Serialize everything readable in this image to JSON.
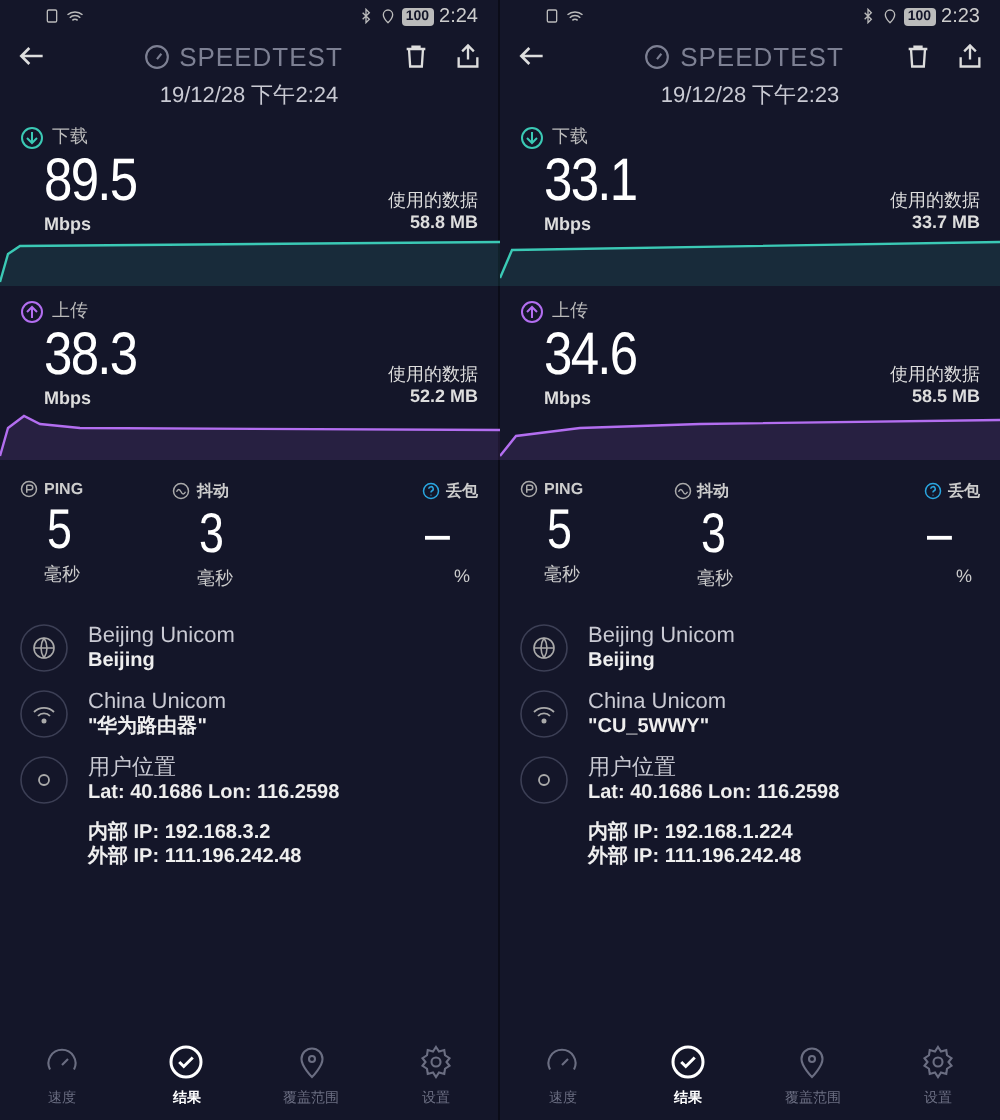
{
  "screens": [
    {
      "status_bar": {
        "battery": "100",
        "time": "2:24"
      },
      "header": {
        "title": "SPEEDTEST"
      },
      "timestamp": "19/12/28 下午2:24",
      "results": [
        {
          "kind": "download",
          "label": "下载",
          "value": "89.5",
          "unit": "Mbps",
          "data_label": "使用的数据",
          "data_value": "58.8 MB"
        },
        {
          "kind": "upload",
          "label": "上传",
          "value": "38.3",
          "unit": "Mbps",
          "data_label": "使用的数据",
          "data_value": "52.2 MB"
        }
      ],
      "stats": [
        {
          "kind": "ping",
          "label": "PING",
          "value": "5",
          "unit": "毫秒"
        },
        {
          "kind": "jitter",
          "label": "抖动",
          "value": "3",
          "unit": "毫秒"
        },
        {
          "kind": "loss",
          "label": "丢包",
          "value": "–",
          "unit": "%"
        }
      ],
      "info": [
        {
          "kind": "server",
          "lines": [
            "Beijing Unicom",
            "Beijing"
          ]
        },
        {
          "kind": "network",
          "lines": [
            "China Unicom",
            "\"华为路由器\""
          ]
        },
        {
          "kind": "location",
          "lines": [
            "用户位置",
            "Lat: 40.1686 Lon: 116.2598",
            "内部 IP: 192.168.3.2",
            "外部 IP: 111.196.242.48"
          ]
        }
      ],
      "nav": [
        {
          "kind": "speed",
          "label": "速度",
          "selected": false
        },
        {
          "kind": "results",
          "label": "结果",
          "selected": true
        },
        {
          "kind": "coverage",
          "label": "覆盖范围",
          "selected": false
        },
        {
          "kind": "settings",
          "label": "设置",
          "selected": false
        }
      ]
    },
    {
      "status_bar": {
        "battery": "100",
        "time": "2:23"
      },
      "header": {
        "title": "SPEEDTEST"
      },
      "timestamp": "19/12/28 下午2:23",
      "results": [
        {
          "kind": "download",
          "label": "下载",
          "value": "33.1",
          "unit": "Mbps",
          "data_label": "使用的数据",
          "data_value": "33.7 MB"
        },
        {
          "kind": "upload",
          "label": "上传",
          "value": "34.6",
          "unit": "Mbps",
          "data_label": "使用的数据",
          "data_value": "58.5 MB"
        }
      ],
      "stats": [
        {
          "kind": "ping",
          "label": "PING",
          "value": "5",
          "unit": "毫秒"
        },
        {
          "kind": "jitter",
          "label": "抖动",
          "value": "3",
          "unit": "毫秒"
        },
        {
          "kind": "loss",
          "label": "丢包",
          "value": "–",
          "unit": "%"
        }
      ],
      "info": [
        {
          "kind": "server",
          "lines": [
            "Beijing Unicom",
            "Beijing"
          ]
        },
        {
          "kind": "network",
          "lines": [
            "China Unicom",
            "\"CU_5WWY\""
          ]
        },
        {
          "kind": "location",
          "lines": [
            "用户位置",
            "Lat: 40.1686 Lon: 116.2598",
            "内部 IP: 192.168.1.224",
            "外部 IP: 111.196.242.48"
          ]
        }
      ],
      "nav": [
        {
          "kind": "speed",
          "label": "速度",
          "selected": false
        },
        {
          "kind": "results",
          "label": "结果",
          "selected": true
        },
        {
          "kind": "coverage",
          "label": "覆盖范围",
          "selected": false
        },
        {
          "kind": "settings",
          "label": "设置",
          "selected": false
        }
      ]
    }
  ]
}
